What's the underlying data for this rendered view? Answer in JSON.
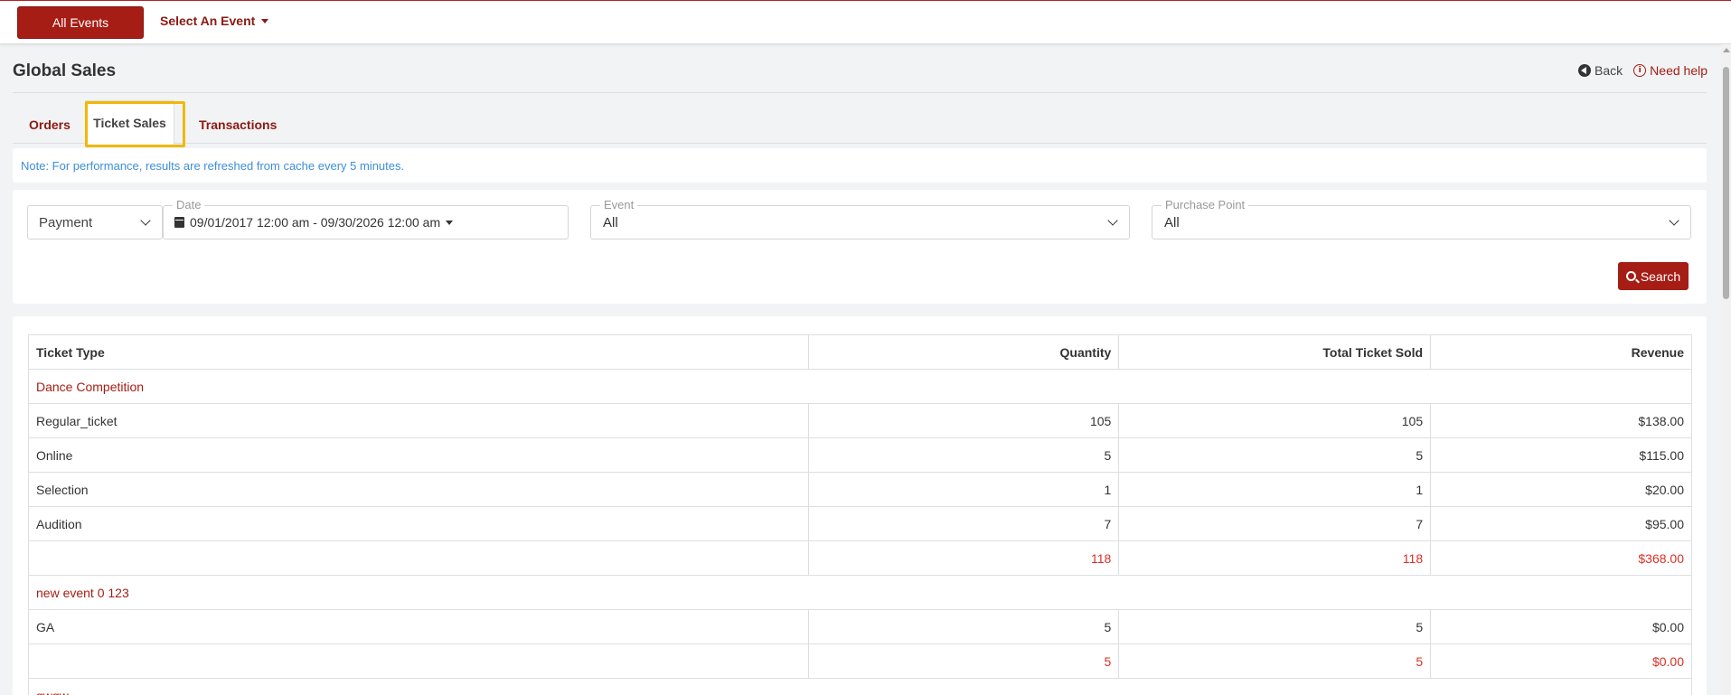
{
  "topbar": {
    "all_events_label": "All Events",
    "select_event_label": "Select An Event"
  },
  "page": {
    "title": "Global Sales",
    "back_label": "Back",
    "help_label": "Need help"
  },
  "tabs": [
    {
      "label": "Orders",
      "active": false
    },
    {
      "label": "Ticket Sales",
      "active": true
    },
    {
      "label": "Transactions",
      "active": false
    }
  ],
  "note": "Note: For performance, results are refreshed from cache every 5 minutes.",
  "filters": {
    "payment_select": "Payment",
    "date": {
      "legend": "Date",
      "value": "09/01/2017 12:00 am - 09/30/2026 12:00 am"
    },
    "event": {
      "legend": "Event",
      "value": "All"
    },
    "purchase_point": {
      "legend": "Purchase Point",
      "value": "All"
    },
    "search_label": "Search"
  },
  "table": {
    "headers": [
      "Ticket Type",
      "Quantity",
      "Total Ticket Sold",
      "Revenue"
    ],
    "groups": [
      {
        "name": "Dance Competition",
        "rows": [
          [
            "Regular_ticket",
            "105",
            "105",
            "$138.00"
          ],
          [
            "Online",
            "5",
            "5",
            "$115.00"
          ],
          [
            "Selection",
            "1",
            "1",
            "$20.00"
          ],
          [
            "Audition",
            "7",
            "7",
            "$95.00"
          ]
        ],
        "total": [
          "",
          "118",
          "118",
          "$368.00"
        ]
      },
      {
        "name": "new event 0 123",
        "rows": [
          [
            "GA",
            "5",
            "5",
            "$0.00"
          ]
        ],
        "total": [
          "",
          "5",
          "5",
          "$0.00"
        ]
      },
      {
        "name": "qwqw",
        "rows": [],
        "total": null
      }
    ]
  },
  "colors": {
    "brand": "#a51d14",
    "total_red": "#d93025",
    "note_blue": "#3d8fd6",
    "tab_highlight": "#f2b705"
  }
}
